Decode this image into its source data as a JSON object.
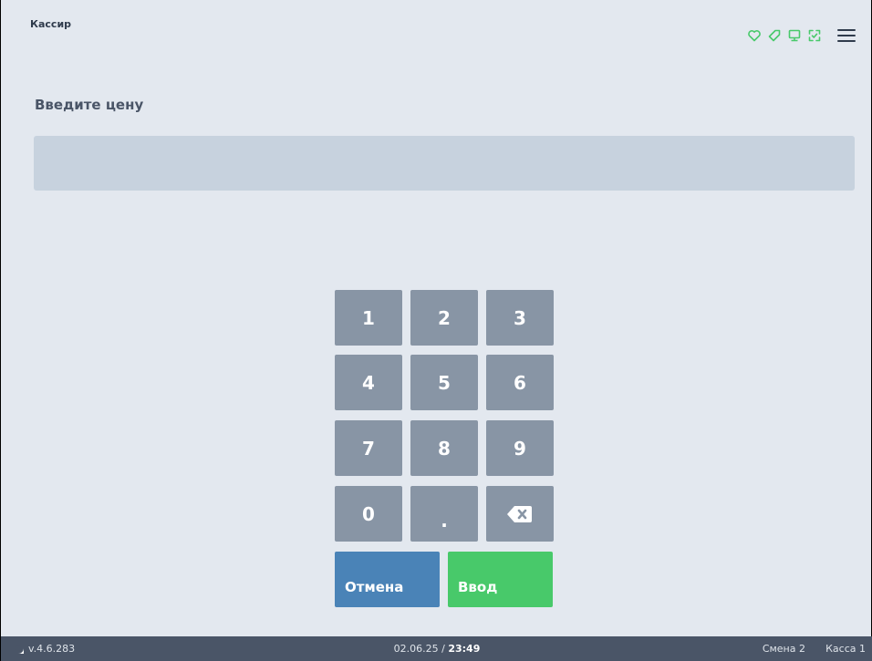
{
  "header": {
    "user": "Кассир",
    "icons": [
      "heart-icon",
      "tag-icon",
      "monitor-icon",
      "scan-icon",
      "menu-icon"
    ],
    "icon_color": "#48c96a"
  },
  "page": {
    "title": "Введите цену",
    "input_value": "",
    "input_placeholder": ""
  },
  "keypad": {
    "keys": [
      "1",
      "2",
      "3",
      "4",
      "5",
      "6",
      "7",
      "8",
      "9",
      "0",
      "."
    ],
    "backspace_icon": "backspace-icon",
    "cancel_label": "Отмена",
    "enter_label": "Ввод",
    "key_color": "#8895a5",
    "cancel_color": "#4a83b7",
    "enter_color": "#48c96a"
  },
  "footer": {
    "version": "v.4.6.283",
    "date": "02.06.25 /",
    "time": "23:49",
    "shift": "Смена 2",
    "register": "Касса 1"
  }
}
